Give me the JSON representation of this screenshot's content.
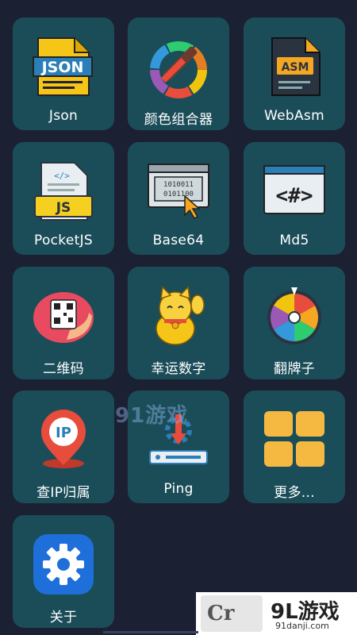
{
  "apps": [
    {
      "label": "Json",
      "icon": "json-file-icon"
    },
    {
      "label": "颜色组合器",
      "icon": "color-picker-icon"
    },
    {
      "label": "WebAsm",
      "icon": "asm-file-icon"
    },
    {
      "label": "PocketJS",
      "icon": "js-file-icon"
    },
    {
      "label": "Base64",
      "icon": "binary-window-icon"
    },
    {
      "label": "Md5",
      "icon": "hash-code-window-icon"
    },
    {
      "label": "二维码",
      "icon": "qr-code-hand-icon"
    },
    {
      "label": "幸运数字",
      "icon": "lucky-cat-icon"
    },
    {
      "label": "翻牌子",
      "icon": "prize-wheel-icon"
    },
    {
      "label": "查IP归属",
      "icon": "ip-location-pin-icon"
    },
    {
      "label": "Ping",
      "icon": "ping-server-icon"
    },
    {
      "label": "更多...",
      "icon": "more-grid-icon"
    },
    {
      "label": "关于",
      "icon": "settings-gear-icon"
    }
  ],
  "icon_text": {
    "json": "JSON",
    "asm": "ASM",
    "js": "JS",
    "ip": "IP"
  },
  "watermark": {
    "center": "91游戏",
    "corner_logo": "Cr",
    "corner_brand": "9L游戏",
    "corner_url": "91danji.com"
  },
  "colors": {
    "background": "#1c2033",
    "tile": "#1b4d59",
    "label": "#ffffff"
  }
}
